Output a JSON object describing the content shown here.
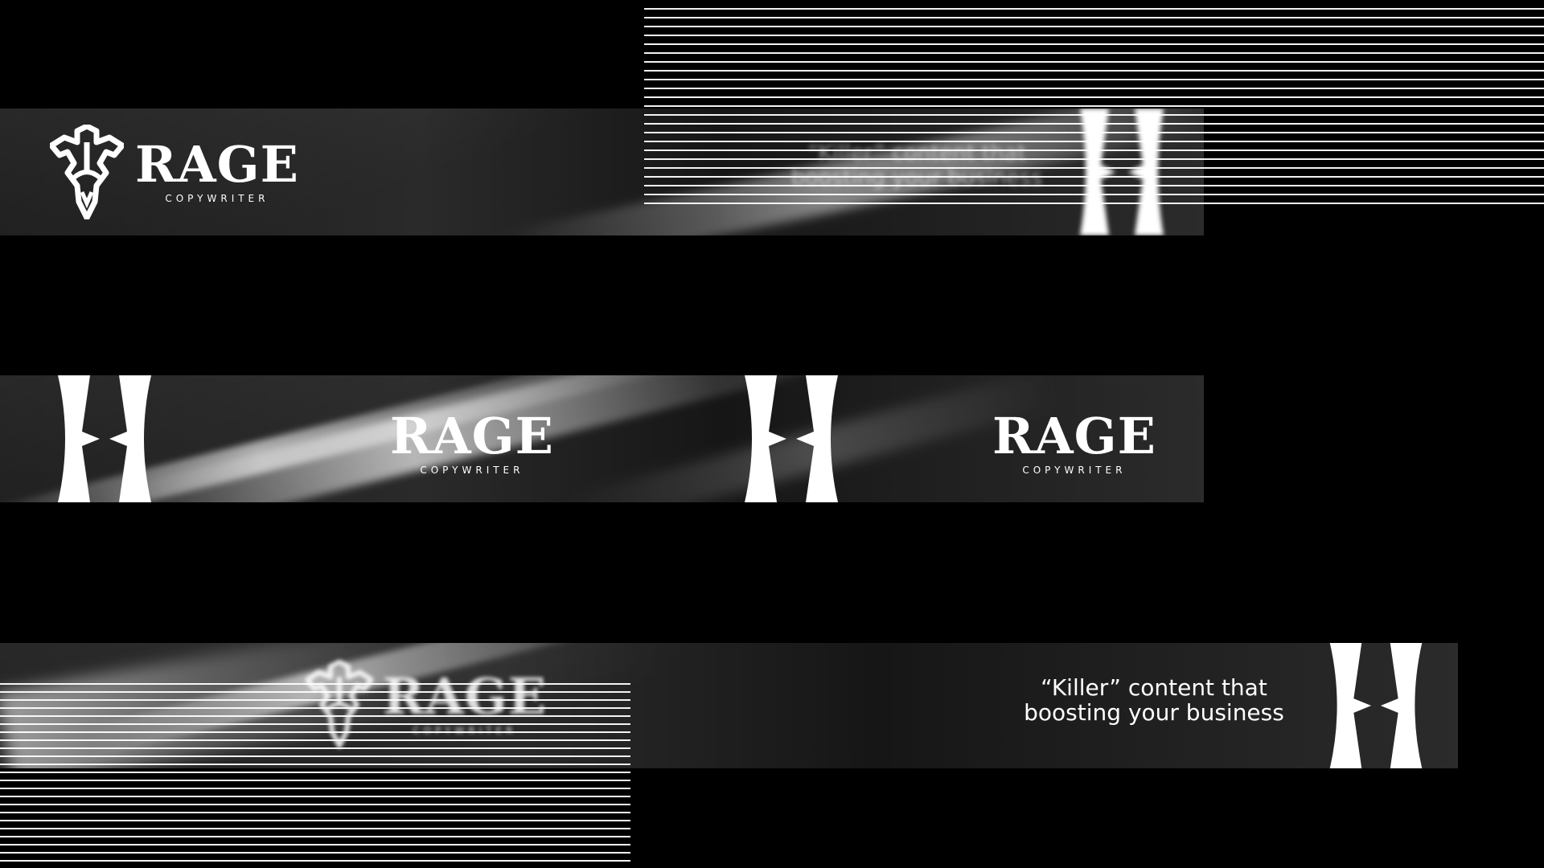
{
  "brand": {
    "name": "RAGE",
    "subtitle": "COPYWRITER"
  },
  "tagline": {
    "line1": "“Killer” content that",
    "line2": "boosting your business"
  },
  "colors": {
    "background": "#000000",
    "foreground": "#ffffff",
    "strip_dark": "#1b1b1b",
    "strip_light": "#2b2b2b"
  },
  "icons": {
    "crest": "rage-crest-icon",
    "emblem": "rage-k-emblem-icon"
  }
}
